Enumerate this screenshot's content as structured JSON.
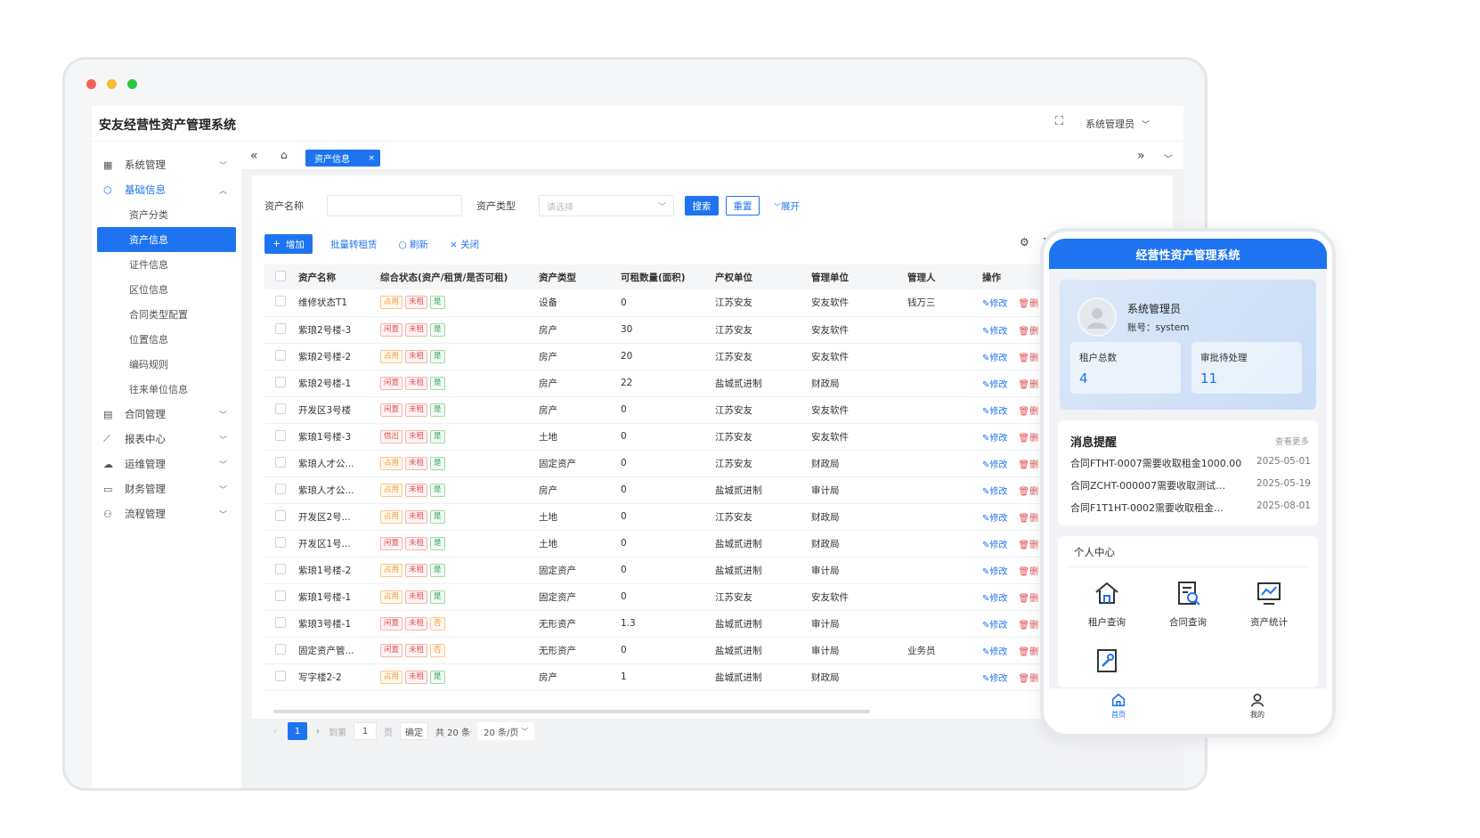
{
  "window": {
    "traffic_colors": [
      "#f26158",
      "#f5bd2f",
      "#2bc640"
    ]
  },
  "app": {
    "title": "安友经营性资产管理系统",
    "user_name": "系统管理员"
  },
  "sidebar": {
    "items": [
      {
        "label": "系统管理",
        "icon": "grid-icon"
      },
      {
        "label": "基础信息",
        "icon": "cube-icon"
      },
      {
        "label": "合同管理",
        "icon": "contract-icon"
      },
      {
        "label": "报表中心",
        "icon": "chart-icon"
      },
      {
        "label": "运维管理",
        "icon": "cloud-icon"
      },
      {
        "label": "财务管理",
        "icon": "finance-icon"
      },
      {
        "label": "流程管理",
        "icon": "flow-icon"
      }
    ],
    "sub_items": [
      "资产分类",
      "资产信息",
      "证件信息",
      "区位信息",
      "合同类型配置",
      "位置信息",
      "编码规则",
      "往来单位信息"
    ]
  },
  "tabs": {
    "active": "资产信息"
  },
  "filter": {
    "name_label": "资产名称",
    "type_label": "资产类型",
    "type_placeholder": "请选择",
    "search": "搜索",
    "reset": "重置",
    "expand": "展开"
  },
  "toolbar": {
    "add": "增加",
    "batch": "批量转租赁",
    "refresh": "刷新",
    "close": "关闭"
  },
  "table": {
    "columns": [
      "资产名称",
      "综合状态(资产/租赁/是否可租)",
      "资产类型",
      "可租数量(面积)",
      "产权单位",
      "管理单位",
      "管理人",
      "操作"
    ],
    "edit_label": "修改",
    "delete_label": "删",
    "rows": [
      {
        "name": "维修状态T1",
        "s1": "占用",
        "s2": "未租",
        "s3": "是",
        "type": "设备",
        "qty": "0",
        "owner": "江苏安友",
        "mgr_unit": "安友软件",
        "mgr": "钱万三"
      },
      {
        "name": "紫琅2号楼-3",
        "s1": "闲置",
        "s2": "未租",
        "s3": "是",
        "type": "房产",
        "qty": "30",
        "owner": "江苏安友",
        "mgr_unit": "安友软件",
        "mgr": ""
      },
      {
        "name": "紫琅2号楼-2",
        "s1": "占用",
        "s2": "未租",
        "s3": "是",
        "type": "房产",
        "qty": "20",
        "owner": "江苏安友",
        "mgr_unit": "安友软件",
        "mgr": ""
      },
      {
        "name": "紫琅2号楼-1",
        "s1": "闲置",
        "s2": "未租",
        "s3": "是",
        "type": "房产",
        "qty": "22",
        "owner": "盐城贰进制",
        "mgr_unit": "财政局",
        "mgr": ""
      },
      {
        "name": "开发区3号楼",
        "s1": "闲置",
        "s2": "未租",
        "s3": "是",
        "type": "房产",
        "qty": "0",
        "owner": "江苏安友",
        "mgr_unit": "安友软件",
        "mgr": ""
      },
      {
        "name": "紫琅1号楼-3",
        "s1": "借出",
        "s2": "未租",
        "s3": "是",
        "type": "土地",
        "qty": "0",
        "owner": "江苏安友",
        "mgr_unit": "安友软件",
        "mgr": ""
      },
      {
        "name": "紫琅人才公...",
        "s1": "占用",
        "s2": "未租",
        "s3": "是",
        "type": "固定资产",
        "qty": "0",
        "owner": "江苏安友",
        "mgr_unit": "财政局",
        "mgr": ""
      },
      {
        "name": "紫琅人才公...",
        "s1": "占用",
        "s2": "未租",
        "s3": "是",
        "type": "房产",
        "qty": "0",
        "owner": "盐城贰进制",
        "mgr_unit": "审计局",
        "mgr": ""
      },
      {
        "name": "开发区2号...",
        "s1": "占用",
        "s2": "未租",
        "s3": "是",
        "type": "土地",
        "qty": "0",
        "owner": "江苏安友",
        "mgr_unit": "财政局",
        "mgr": ""
      },
      {
        "name": "开发区1号...",
        "s1": "闲置",
        "s2": "未租",
        "s3": "是",
        "type": "土地",
        "qty": "0",
        "owner": "盐城贰进制",
        "mgr_unit": "财政局",
        "mgr": ""
      },
      {
        "name": "紫琅1号楼-2",
        "s1": "占用",
        "s2": "未租",
        "s3": "是",
        "type": "固定资产",
        "qty": "0",
        "owner": "盐城贰进制",
        "mgr_unit": "审计局",
        "mgr": ""
      },
      {
        "name": "紫琅1号楼-1",
        "s1": "占用",
        "s2": "未租",
        "s3": "是",
        "type": "固定资产",
        "qty": "0",
        "owner": "江苏安友",
        "mgr_unit": "安友软件",
        "mgr": ""
      },
      {
        "name": "紫琅3号楼-1",
        "s1": "闲置",
        "s2": "未租",
        "s3": "否",
        "type": "无形资产",
        "qty": "1.3",
        "owner": "盐城贰进制",
        "mgr_unit": "审计局",
        "mgr": ""
      },
      {
        "name": "固定资产管...",
        "s1": "闲置",
        "s2": "未租",
        "s3": "否",
        "type": "无形资产",
        "qty": "0",
        "owner": "盐城贰进制",
        "mgr_unit": "审计局",
        "mgr": "业务员"
      },
      {
        "name": "写字楼2-2",
        "s1": "占用",
        "s2": "未租",
        "s3": "是",
        "type": "房产",
        "qty": "1",
        "owner": "盐城贰进制",
        "mgr_unit": "财政局",
        "mgr": ""
      }
    ]
  },
  "pager": {
    "current": "1",
    "goto": "到第",
    "goto_value": "1",
    "page_unit": "页",
    "confirm": "确定",
    "total": "共 20 条",
    "size": "20 条/页"
  },
  "phone": {
    "title": "经营性资产管理系统",
    "user_name": "系统管理员",
    "account": "账号：system",
    "stats": [
      {
        "label": "租户总数",
        "value": "4"
      },
      {
        "label": "审批待处理",
        "value": "11"
      }
    ],
    "messages_title": "消息提醒",
    "more": "查看更多",
    "messages": [
      {
        "text": "合同FTHT-0007需要收取租金1000.00",
        "date": "2025-05-01"
      },
      {
        "text": "合同ZCHT-000007需要收取测试…",
        "date": "2025-05-19"
      },
      {
        "text": "合同F1T1HT-0002需要收取租金…",
        "date": "2025-08-01"
      }
    ],
    "personal_title": "个人中心",
    "tiles": [
      {
        "label": "租户查询",
        "icon": "house-icon"
      },
      {
        "label": "合同查询",
        "icon": "contract-search-icon"
      },
      {
        "label": "资产统计",
        "icon": "asset-chart-icon"
      }
    ],
    "footer": [
      {
        "label": "首页",
        "icon": "home-icon"
      },
      {
        "label": "我的",
        "icon": "user-icon"
      }
    ]
  }
}
